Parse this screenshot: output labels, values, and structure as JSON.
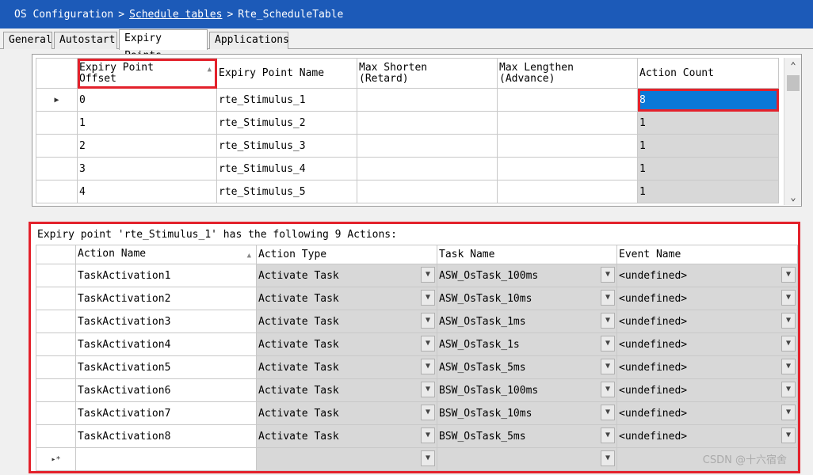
{
  "breadcrumb": {
    "root": "OS Configuration",
    "separator": ">",
    "middle": "Schedule tables",
    "current": "Rte_ScheduleTable"
  },
  "tabs": [
    {
      "label": "General"
    },
    {
      "label": "Autostart"
    },
    {
      "label": "Expiry Points",
      "active": true
    },
    {
      "label": "Applications"
    }
  ],
  "expiry_grid": {
    "headers": {
      "offset": "Expiry Point Offset",
      "name": "Expiry Point Name",
      "max_shorten": "Max Shorten (Retard)",
      "max_lengthen": "Max Lengthen (Advance)",
      "action_count": "Action Count"
    },
    "rows": [
      {
        "offset": "0",
        "name": "rte_Stimulus_1",
        "max_shorten": "",
        "max_lengthen": "",
        "action_count": "8"
      },
      {
        "offset": "1",
        "name": "rte_Stimulus_2",
        "max_shorten": "",
        "max_lengthen": "",
        "action_count": "1"
      },
      {
        "offset": "2",
        "name": "rte_Stimulus_3",
        "max_shorten": "",
        "max_lengthen": "",
        "action_count": "1"
      },
      {
        "offset": "3",
        "name": "rte_Stimulus_4",
        "max_shorten": "",
        "max_lengthen": "",
        "action_count": "1"
      },
      {
        "offset": "4",
        "name": "rte_Stimulus_5",
        "max_shorten": "",
        "max_lengthen": "",
        "action_count": "1"
      }
    ]
  },
  "actions": {
    "caption": "Expiry point 'rte_Stimulus_1' has the following 9 Actions:",
    "headers": {
      "action_name": "Action Name",
      "action_type": "Action Type",
      "task_name": "Task Name",
      "event_name": "Event Name"
    },
    "rows": [
      {
        "action_name": "TaskActivation1",
        "action_type": "Activate Task",
        "task_name": "ASW_OsTask_100ms",
        "event_name": "<undefined>"
      },
      {
        "action_name": "TaskActivation2",
        "action_type": "Activate Task",
        "task_name": "ASW_OsTask_10ms",
        "event_name": "<undefined>"
      },
      {
        "action_name": "TaskActivation3",
        "action_type": "Activate Task",
        "task_name": "ASW_OsTask_1ms",
        "event_name": "<undefined>"
      },
      {
        "action_name": "TaskActivation4",
        "action_type": "Activate Task",
        "task_name": "ASW_OsTask_1s",
        "event_name": "<undefined>"
      },
      {
        "action_name": "TaskActivation5",
        "action_type": "Activate Task",
        "task_name": "ASW_OsTask_5ms",
        "event_name": "<undefined>"
      },
      {
        "action_name": "TaskActivation6",
        "action_type": "Activate Task",
        "task_name": "BSW_OsTask_100ms",
        "event_name": "<undefined>"
      },
      {
        "action_name": "TaskActivation7",
        "action_type": "Activate Task",
        "task_name": "BSW_OsTask_10ms",
        "event_name": "<undefined>"
      },
      {
        "action_name": "TaskActivation8",
        "action_type": "Activate Task",
        "task_name": "BSW_OsTask_5ms",
        "event_name": "<undefined>"
      }
    ],
    "new_row_marker": "▸*"
  },
  "current_row_marker": "▶",
  "watermark": "CSDN @十六宿舍",
  "icons": {
    "sort": "sort-ascending-icon",
    "dropdown": "chevron-down-icon",
    "scroll_up": "scroll-up-icon",
    "scroll_down": "scroll-down-icon"
  },
  "colors": {
    "titlebar": "#1c5ab8",
    "highlight": "#e3212b",
    "selection": "#0a78d7"
  }
}
